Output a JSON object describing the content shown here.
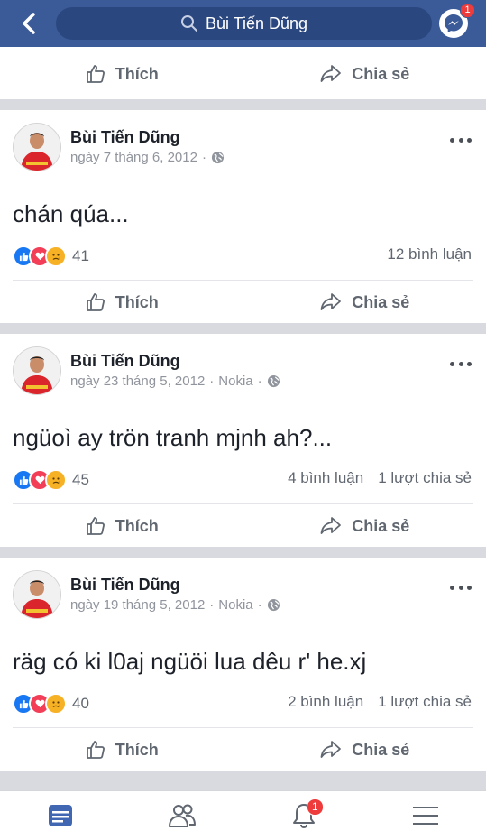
{
  "header": {
    "search_text": "Bùi Tiến Dũng",
    "messenger_badge": "1"
  },
  "top_actions": {
    "like_label": "Thích",
    "share_label": "Chia sẻ"
  },
  "posts": [
    {
      "author": "Bùi Tiến Dũng",
      "date": "ngày 7 tháng 6, 2012",
      "source": "",
      "text": "chán qúa...",
      "reaction_count": "41",
      "comments": "12 bình luận",
      "shares": "",
      "like_label": "Thích",
      "share_label": "Chia sẻ"
    },
    {
      "author": "Bùi Tiến Dũng",
      "date": "ngày 23 tháng 5, 2012",
      "source": "Nokia",
      "text": "ngüoì ay trön tranh mjnh ah?...",
      "reaction_count": "45",
      "comments": "4 bình luận",
      "shares": "1 lượt chia sẻ",
      "like_label": "Thích",
      "share_label": "Chia sẻ"
    },
    {
      "author": "Bùi Tiến Dũng",
      "date": "ngày 19 tháng 5, 2012",
      "source": "Nokia",
      "text": "räg có ki l0aj ngüöi lua dêu r' he.xj",
      "reaction_count": "40",
      "comments": "2 bình luận",
      "shares": "1 lượt chia sẻ",
      "like_label": "Thích",
      "share_label": "Chia sẻ"
    }
  ],
  "bottom_nav": {
    "notifications_badge": "1"
  },
  "colors": {
    "brand": "#3b5a98",
    "like_blue": "#1877f2",
    "love_red": "#f33e58",
    "sad_yellow": "#f7b125"
  }
}
